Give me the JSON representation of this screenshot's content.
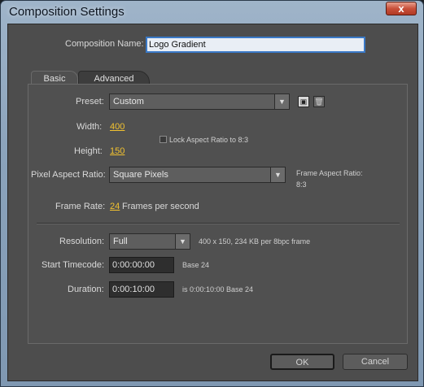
{
  "window": {
    "title": "Composition Settings",
    "close_glyph": "x"
  },
  "composition_name": {
    "label": "Composition Name:",
    "value": "Logo Gradient"
  },
  "tabs": [
    {
      "label": "Basic"
    },
    {
      "label": "Advanced"
    }
  ],
  "preset": {
    "label": "Preset:",
    "value": "Custom",
    "save_icon": "save-preset-icon",
    "delete_icon": "trash-icon"
  },
  "width": {
    "label": "Width:",
    "value": "400"
  },
  "height": {
    "label": "Height:",
    "value": "150"
  },
  "lock_aspect": {
    "label": "Lock Aspect Ratio to 8:3",
    "checked": false
  },
  "pixel_aspect": {
    "label": "Pixel Aspect Ratio:",
    "value": "Square Pixels",
    "frame_aspect_label": "Frame Aspect Ratio:",
    "frame_aspect_value": "8:3"
  },
  "frame_rate": {
    "label": "Frame Rate:",
    "value": "24",
    "unit": "Frames per second"
  },
  "resolution": {
    "label": "Resolution:",
    "value": "Full",
    "info": "400 x 150, 234 KB per 8bpc frame"
  },
  "start_timecode": {
    "label": "Start Timecode:",
    "value": "0:00:00:00",
    "base": "Base 24"
  },
  "duration": {
    "label": "Duration:",
    "value": "0:00:10:00",
    "info": "is 0:00:10:00  Base 24"
  },
  "buttons": {
    "ok": "OK",
    "cancel": "Cancel"
  }
}
